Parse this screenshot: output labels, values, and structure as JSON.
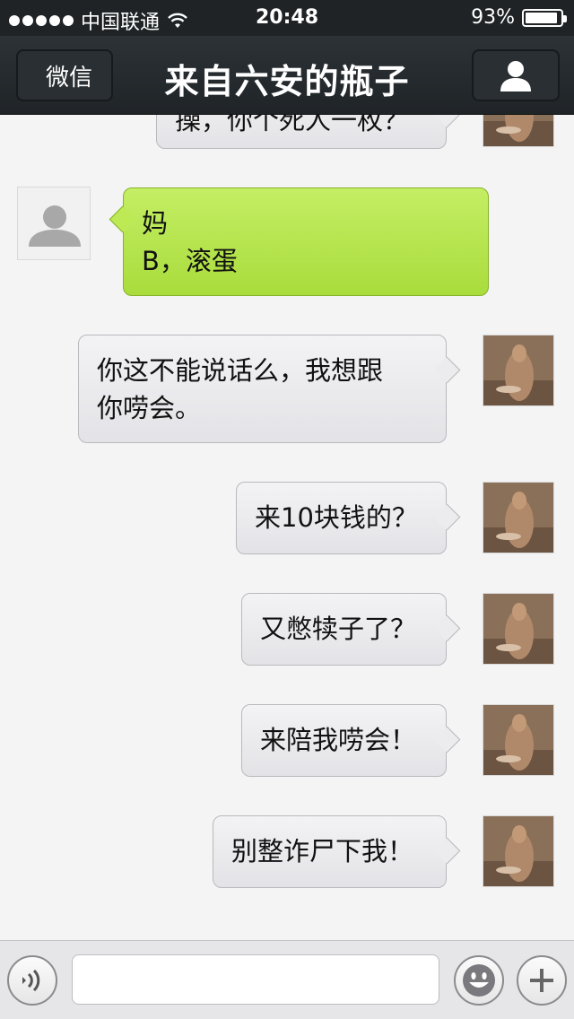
{
  "status_bar": {
    "carrier": "中国联通",
    "time": "20:48",
    "battery_percent": "93%",
    "battery_level": 0.93
  },
  "nav": {
    "back_label": "微信",
    "title": "来自六安的瓶子"
  },
  "messages": [
    {
      "side": "out",
      "lines": [
        "操，你个死人一枚？"
      ]
    },
    {
      "side": "in",
      "lines": [
        "妈",
        "B，滚蛋"
      ]
    },
    {
      "side": "out",
      "lines": [
        "你这不能说话么，我想跟",
        "你唠会。"
      ]
    },
    {
      "side": "out",
      "lines": [
        "来10块钱的？"
      ]
    },
    {
      "side": "out",
      "lines": [
        "又憋犊子了？"
      ]
    },
    {
      "side": "out",
      "lines": [
        "来陪我唠会！"
      ]
    },
    {
      "side": "out",
      "lines": [
        "别整诈尸下我！"
      ]
    }
  ],
  "input_bar": {
    "placeholder": ""
  },
  "icons": {
    "voice": "voice-icon",
    "emoji": "emoji-icon",
    "plus": "plus-icon",
    "profile": "person-icon",
    "wifi": "wifi-icon"
  }
}
